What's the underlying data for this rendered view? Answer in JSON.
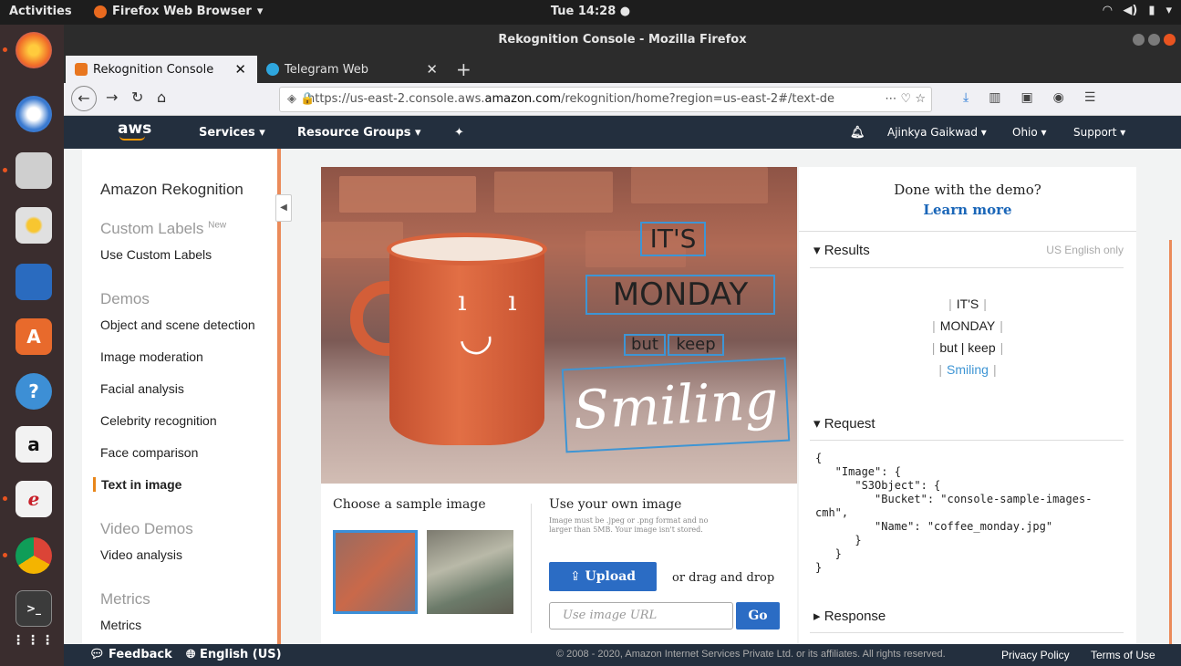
{
  "os": {
    "activities": "Activities",
    "app_name": "Firefox Web Browser",
    "clock": "Tue 14:28 ●",
    "tray": [
      "wifi-icon",
      "volume-icon",
      "battery-icon",
      "menu-icon"
    ]
  },
  "dock": [
    "firefox",
    "thunderbird",
    "files",
    "rhythmbox",
    "libreoffice-writer",
    "software-center",
    "help",
    "amazon",
    "document-viewer",
    "chrome",
    "terminal",
    "app-grid"
  ],
  "browser": {
    "window_title": "Rekognition Console - Mozilla Firefox",
    "tabs": [
      {
        "label": "Rekognition Console",
        "active": true
      },
      {
        "label": "Telegram Web",
        "active": false
      }
    ],
    "url_prefix": "https://us-east-2.console.aws.",
    "url_domain": "amazon.com",
    "url_suffix": "/rekognition/home?region=us-east-2#/text-de",
    "url_icons": "⋯ ♡ ☆"
  },
  "aws_nav": {
    "logo": "aws",
    "services": "Services ▾",
    "resource_groups": "Resource Groups ▾",
    "user": "Ajinkya Gaikwad ▾",
    "region": "Ohio ▾",
    "support": "Support ▾"
  },
  "sidebar": {
    "title": "Amazon Rekognition",
    "custom_labels": "Custom Labels",
    "new_badge": "New",
    "use_custom_labels": "Use Custom Labels",
    "demos": "Demos",
    "items": [
      "Object and scene detection",
      "Image moderation",
      "Facial analysis",
      "Celebrity recognition",
      "Face comparison",
      "Text in image"
    ],
    "video_demos": "Video Demos",
    "video_analysis": "Video analysis",
    "metrics_heading": "Metrics",
    "metrics_item": "Metrics"
  },
  "demo": {
    "detected_words": [
      "IT'S",
      "MONDAY",
      "but",
      "keep",
      "Smiling"
    ],
    "choose_sample": "Choose a sample image",
    "use_own": "Use your own image",
    "own_desc": "Image must be .jpeg or .png format and no larger than 5MB. Your image isn't stored.",
    "upload": "Upload",
    "drag_drop": "or drag and drop",
    "url_placeholder": "Use image URL",
    "go": "Go"
  },
  "right": {
    "done": "Done with the demo?",
    "learn_more": "Learn more",
    "results": "Results",
    "us_english": "US English only",
    "result_lines": [
      "IT'S",
      "MONDAY",
      "but | keep",
      "Smiling"
    ],
    "request": "Request",
    "request_json": "{\n   \"Image\": {\n      \"S3Object\": {\n         \"Bucket\": \"console-sample-images-\ncmh\",\n         \"Name\": \"coffee_monday.jpg\"\n      }\n   }\n}",
    "response": "Response"
  },
  "footer": {
    "feedback": "Feedback",
    "language": "English (US)",
    "copyright": "© 2008 - 2020, Amazon Internet Services Private Ltd. or its affiliates. All rights reserved.",
    "privacy": "Privacy Policy",
    "terms": "Terms of Use"
  },
  "colors": {
    "aws_nav": "#232f3e",
    "accent_orange": "#eb8b5a",
    "link_blue": "#1a66b8",
    "button_blue": "#2b6cc4"
  }
}
